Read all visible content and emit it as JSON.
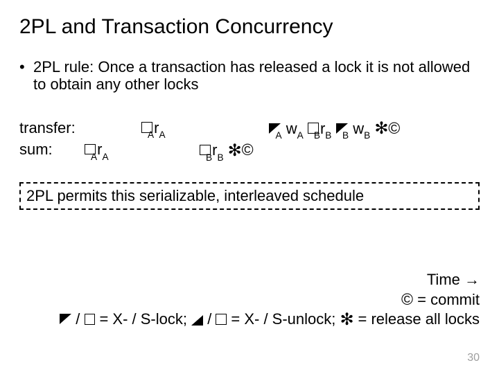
{
  "title": "2PL and Transaction Concurrency",
  "bullet": "2PL rule: Once a transaction has released a lock it is not allowed to obtain any other locks",
  "sched": {
    "row1": {
      "label": "transfer:",
      "t2": {
        "sym": "box",
        "sub": "A",
        "tok": "r",
        "tsub": "A"
      },
      "t4": [
        {
          "sym": "triup",
          "sub": "A",
          "tok": "w",
          "tsub": "A"
        },
        {
          "sym": "box",
          "sub": "B",
          "tok": "r",
          "tsub": "B"
        },
        {
          "sym": "triup",
          "sub": "B",
          "tok": "w",
          "tsub": "B"
        }
      ],
      "tail": [
        "star",
        "commit"
      ]
    },
    "row2": {
      "label": "sum:",
      "t1": {
        "sym": "box",
        "sub": "A",
        "tok": "r",
        "tsub": "A"
      },
      "t3": {
        "sym": "box",
        "sub": "B",
        "tok": "r",
        "tsub": "B"
      },
      "tail3": [
        "star",
        "commit"
      ]
    }
  },
  "permits": "2PL permits this serializable, interleaved schedule",
  "legend": {
    "time": "Time →",
    "commit_sym": "©",
    "commit_text": " = commit",
    "lock_pre": " / ",
    "lock_text": " = X- / S-lock;  ",
    "unlock_pre": " / ",
    "unlock_text": " = X- / S-unlock;  ",
    "release_sym": "✻",
    "release_text": "  = release all locks"
  },
  "pagenum": "30"
}
